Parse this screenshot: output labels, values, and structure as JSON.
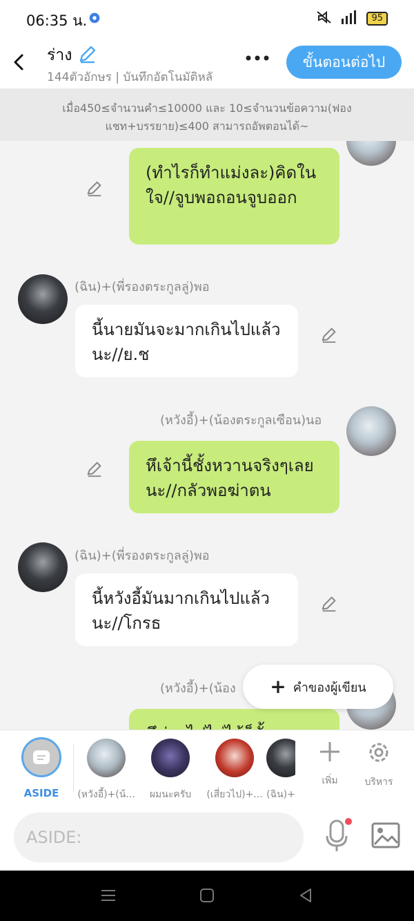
{
  "status_bar": {
    "time": "06:35 น.",
    "battery": "95"
  },
  "header": {
    "title": "ร่าง",
    "subtitle": "144ตัวอักษร | บันทึกอัตโนมัติหลั",
    "next_label": "ขั้นตอนต่อไป"
  },
  "notice": {
    "text": "เมื่อ450≤จำนวนคำ≤10000 และ 10≤จำนวนข้อความ(ฟองแชท+บรรยาย)≤400 สามารถอัพตอนได้~"
  },
  "messages": [
    {
      "side": "right",
      "name": "",
      "text": "(ทำไรก็ทำแม่งละ)คิดในใจ//จูบพอถอนจูบออก"
    },
    {
      "side": "left",
      "name": "(ฉิน)+(พี่รองตระกูลลู่)พอ",
      "text": "นี้นายมันจะมากเกินไปแล้วนะ//ย.ช"
    },
    {
      "side": "right",
      "name": "(หวังอี้)+(น้องตระกูลเซือน)นอ",
      "text": "หึเจ้านี้ชั้งหวานจริงๆเลยนะ//กลัวพอฆ่าตน"
    },
    {
      "side": "left",
      "name": "(ฉิน)+(พี่รองตระกูลลู่)พอ",
      "text": "นี้หวังอี้มันมากเกินไปแล้วนะ//โกรธ"
    },
    {
      "side": "right",
      "name": "(หวังอี้)+(น้อง",
      "text": "หึช่วยไปไม่ได้ก็ยั้"
    }
  ],
  "author_note": {
    "label": "คำของผู้เขียน"
  },
  "characters": {
    "aside_label": "ASIDE",
    "items": [
      {
        "label": "(หวังอี้)+(น้..."
      },
      {
        "label": "ผมนะครับ"
      },
      {
        "label": "(เสี่ยวไป)+..."
      },
      {
        "label": "(ฉิน)+"
      }
    ],
    "add_label": "เพิ่ม",
    "manage_label": "บริหาร"
  },
  "input": {
    "placeholder": "ASIDE:"
  }
}
